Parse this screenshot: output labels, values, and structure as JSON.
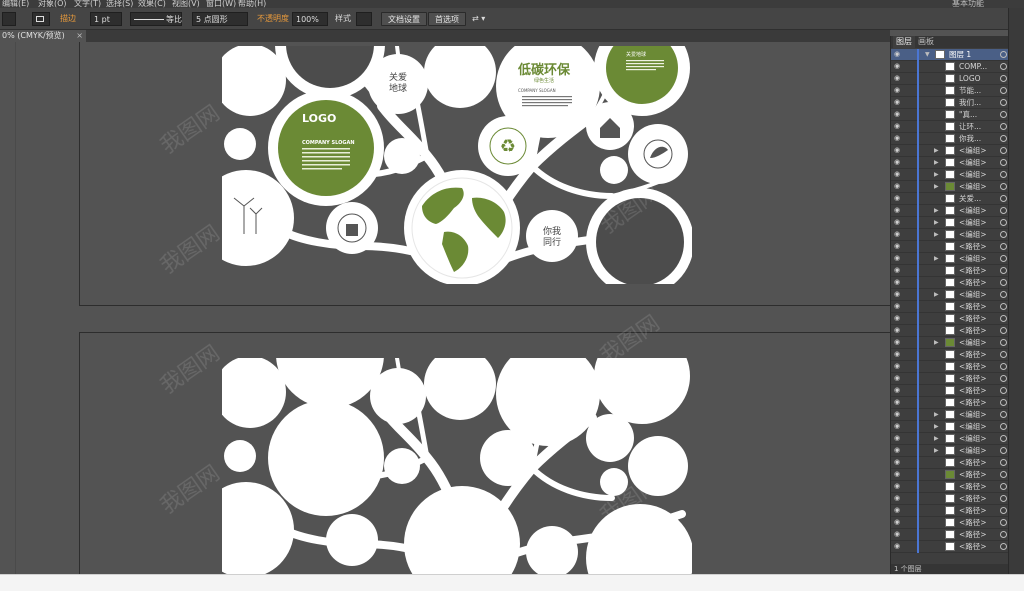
{
  "menu": {
    "items": [
      "编辑(E)",
      "对象(O)",
      "文字(T)",
      "选择(S)",
      "效果(C)",
      "视图(V)",
      "窗口(W)",
      "帮助(H)"
    ],
    "workspace": "基本功能"
  },
  "control": {
    "stroke_label": "描边",
    "stroke_weight": "1 pt",
    "profile_label": "等比",
    "brush_label": "5 点圆形",
    "opacity_label": "不透明度",
    "opacity_value": "100%",
    "style_label": "样式",
    "doc_setup_button": "文档设置",
    "prefs_button": "首选项"
  },
  "document_tab": {
    "title": "0% (CMYK/预览)",
    "close": "×"
  },
  "panel": {
    "tabs": [
      "图层",
      "画板"
    ],
    "footer": "1 个图层",
    "layers": [
      {
        "name": "图层 1",
        "level": 0,
        "expand": "▼",
        "thumb": "white"
      },
      {
        "name": "COMP...",
        "level": 1,
        "expand": "",
        "thumb": "white"
      },
      {
        "name": "LOGO",
        "level": 1,
        "expand": "",
        "thumb": "white"
      },
      {
        "name": "节能...",
        "level": 1,
        "expand": "",
        "thumb": "white"
      },
      {
        "name": "我们...",
        "level": 1,
        "expand": "",
        "thumb": "white"
      },
      {
        "name": "\"真...",
        "level": 1,
        "expand": "",
        "thumb": "white"
      },
      {
        "name": "让环...",
        "level": 1,
        "expand": "",
        "thumb": "white"
      },
      {
        "name": "你我...",
        "level": 1,
        "expand": "",
        "thumb": "white"
      },
      {
        "name": "<编组>",
        "level": 1,
        "expand": "▶",
        "thumb": "white"
      },
      {
        "name": "<编组>",
        "level": 1,
        "expand": "▶",
        "thumb": "white"
      },
      {
        "name": "<编组>",
        "level": 1,
        "expand": "▶",
        "thumb": "white"
      },
      {
        "name": "<编组>",
        "level": 1,
        "expand": "▶",
        "thumb": "green"
      },
      {
        "name": "关爱...",
        "level": 1,
        "expand": "",
        "thumb": "white"
      },
      {
        "name": "<编组>",
        "level": 1,
        "expand": "▶",
        "thumb": "white"
      },
      {
        "name": "<编组>",
        "level": 1,
        "expand": "▶",
        "thumb": "white"
      },
      {
        "name": "<编组>",
        "level": 1,
        "expand": "▶",
        "thumb": "white"
      },
      {
        "name": "<路径>",
        "level": 1,
        "expand": "",
        "thumb": "white"
      },
      {
        "name": "<编组>",
        "level": 1,
        "expand": "▶",
        "thumb": "white"
      },
      {
        "name": "<路径>",
        "level": 1,
        "expand": "",
        "thumb": "white"
      },
      {
        "name": "<路径>",
        "level": 1,
        "expand": "",
        "thumb": "white"
      },
      {
        "name": "<编组>",
        "level": 1,
        "expand": "▶",
        "thumb": "white"
      },
      {
        "name": "<路径>",
        "level": 1,
        "expand": "",
        "thumb": "white"
      },
      {
        "name": "<路径>",
        "level": 1,
        "expand": "",
        "thumb": "white"
      },
      {
        "name": "<路径>",
        "level": 1,
        "expand": "",
        "thumb": "white"
      },
      {
        "name": "<编组>",
        "level": 1,
        "expand": "▶",
        "thumb": "green"
      },
      {
        "name": "<路径>",
        "level": 1,
        "expand": "",
        "thumb": "white"
      },
      {
        "name": "<路径>",
        "level": 1,
        "expand": "",
        "thumb": "white"
      },
      {
        "name": "<路径>",
        "level": 1,
        "expand": "",
        "thumb": "white"
      },
      {
        "name": "<路径>",
        "level": 1,
        "expand": "",
        "thumb": "white"
      },
      {
        "name": "<路径>",
        "level": 1,
        "expand": "",
        "thumb": "white"
      },
      {
        "name": "<编组>",
        "level": 1,
        "expand": "▶",
        "thumb": "white"
      },
      {
        "name": "<编组>",
        "level": 1,
        "expand": "▶",
        "thumb": "white"
      },
      {
        "name": "<编组>",
        "level": 1,
        "expand": "▶",
        "thumb": "white"
      },
      {
        "name": "<编组>",
        "level": 1,
        "expand": "▶",
        "thumb": "white"
      },
      {
        "name": "<路径>",
        "level": 1,
        "expand": "",
        "thumb": "white"
      },
      {
        "name": "<路径>",
        "level": 1,
        "expand": "",
        "thumb": "green"
      },
      {
        "name": "<路径>",
        "level": 1,
        "expand": "",
        "thumb": "white"
      },
      {
        "name": "<路径>",
        "level": 1,
        "expand": "",
        "thumb": "white"
      },
      {
        "name": "<路径>",
        "level": 1,
        "expand": "",
        "thumb": "white"
      },
      {
        "name": "<路径>",
        "level": 1,
        "expand": "",
        "thumb": "white"
      },
      {
        "name": "<路径>",
        "level": 1,
        "expand": "",
        "thumb": "white"
      },
      {
        "name": "<路径>",
        "level": 1,
        "expand": "",
        "thumb": "white"
      }
    ]
  },
  "artwork": {
    "logo": "LOGO",
    "company_slogan": "COMPANY SLOGAN",
    "caring_earth": "关爱\n地球",
    "you_and_me": "你我\n同行",
    "low_carbon_title": "低碳环保",
    "low_carbon_sub": "绿色生活",
    "caring_earth_small": "关爱地球",
    "tagline": "COMPANY SLOGAN"
  },
  "watermark": "我图网",
  "colors": {
    "green": "#6b8a35",
    "dark_green": "#55722a",
    "dark_gray_circle": "#4c4c4c",
    "canvas": "#535353",
    "white": "#ffffff"
  }
}
